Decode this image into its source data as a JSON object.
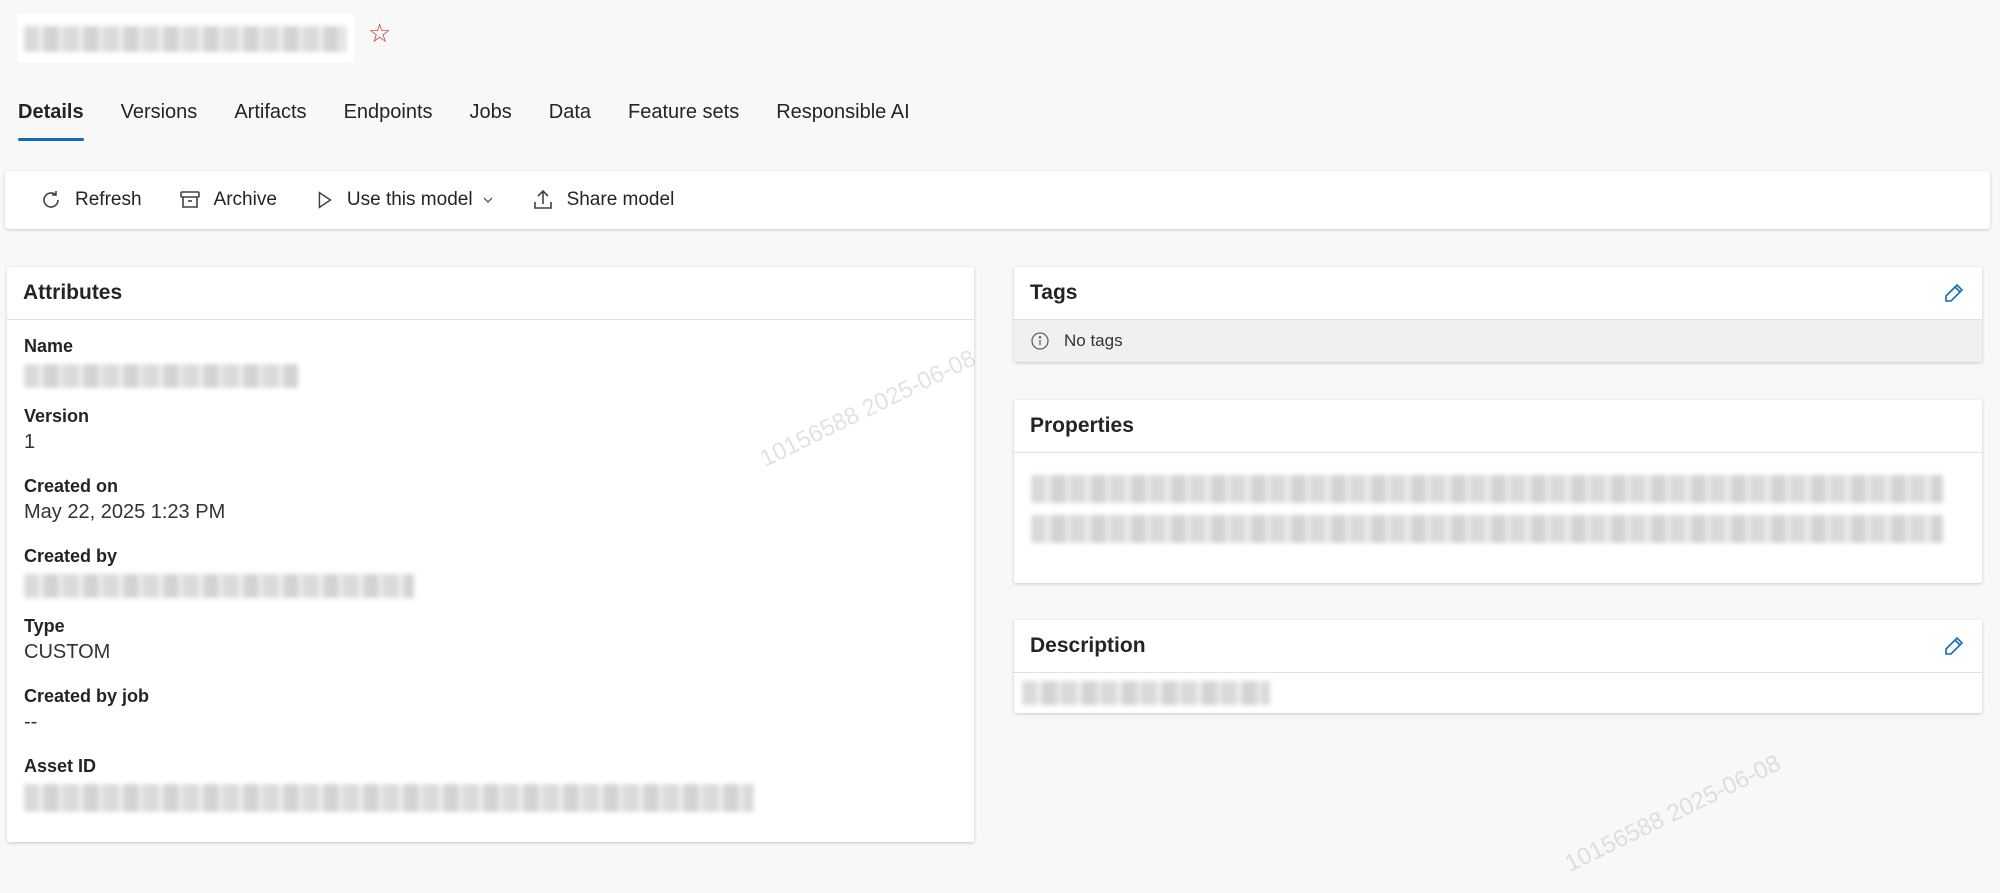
{
  "header": {
    "title": "",
    "star_glyph": "☆"
  },
  "tabs": [
    {
      "label": "Details",
      "active": true
    },
    {
      "label": "Versions"
    },
    {
      "label": "Artifacts"
    },
    {
      "label": "Endpoints"
    },
    {
      "label": "Jobs"
    },
    {
      "label": "Data"
    },
    {
      "label": "Feature sets"
    },
    {
      "label": "Responsible AI"
    }
  ],
  "toolbar": {
    "refresh_label": "Refresh",
    "archive_label": "Archive",
    "use_model_label": "Use this model",
    "share_label": "Share model"
  },
  "attributes": {
    "title": "Attributes",
    "name_label": "Name",
    "version_label": "Version",
    "version_value": "1",
    "created_on_label": "Created on",
    "created_on_value": "May 22, 2025 1:23 PM",
    "created_by_label": "Created by",
    "type_label": "Type",
    "type_value": "CUSTOM",
    "created_by_job_label": "Created by job",
    "created_by_job_value": "--",
    "asset_id_label": "Asset ID"
  },
  "tags": {
    "title": "Tags",
    "empty_text": "No tags"
  },
  "properties": {
    "title": "Properties"
  },
  "description": {
    "title": "Description"
  },
  "watermark": "10156588  2025-06-08",
  "colors": {
    "accent": "#0f6cbd",
    "star": "#c4372a",
    "background": "#f8f8f8"
  },
  "icons": [
    "star-icon",
    "refresh-icon",
    "archive-icon",
    "play-icon",
    "chevron-down-icon",
    "share-icon",
    "edit-icon",
    "info-icon"
  ]
}
